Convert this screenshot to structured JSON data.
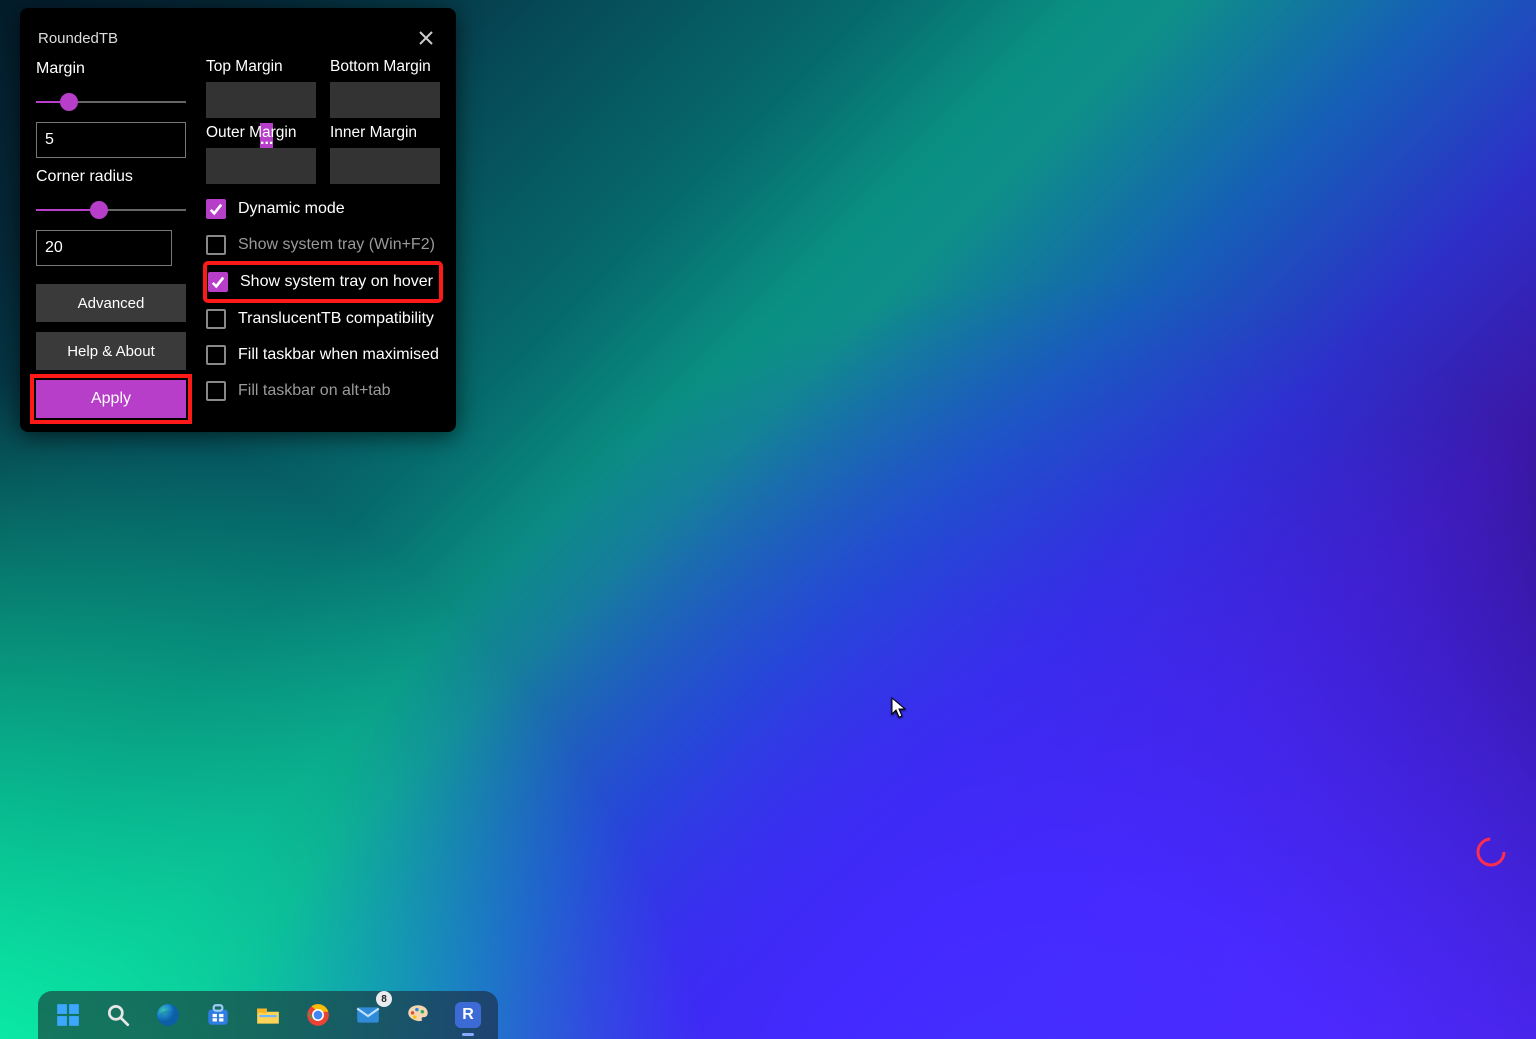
{
  "window": {
    "title": "RoundedTB",
    "close_icon": "close-icon"
  },
  "left": {
    "margin_label": "Margin",
    "margin_value": "5",
    "margin_slider_pct": 22,
    "margin_more_label": "...",
    "corner_label": "Corner radius",
    "corner_value": "20",
    "corner_slider_pct": 42,
    "advanced_label": "Advanced",
    "help_label": "Help & About",
    "apply_label": "Apply"
  },
  "right": {
    "top_margin_label": "Top Margin",
    "bottom_margin_label": "Bottom Margin",
    "outer_margin_label": "Outer Margin",
    "inner_margin_label": "Inner Margin",
    "checks": {
      "dynamic": "Dynamic mode",
      "tray": "Show system tray (Win+F2)",
      "hover": "Show system tray on hover",
      "compat": "TranslucentTB compatibility",
      "fillmax": "Fill taskbar when maximised",
      "fillalt": "Fill taskbar on alt+tab"
    }
  },
  "taskbar": {
    "start": "start-icon",
    "search": "search-icon",
    "edge": "edge-icon",
    "store": "store-icon",
    "explorer": "file-explorer-icon",
    "chrome": "chrome-icon",
    "mail": "mail-icon",
    "mail_badge": "8",
    "paint": "paint-icon",
    "roundedtb": "roundedtb-icon",
    "roundedtb_letter": "R"
  }
}
